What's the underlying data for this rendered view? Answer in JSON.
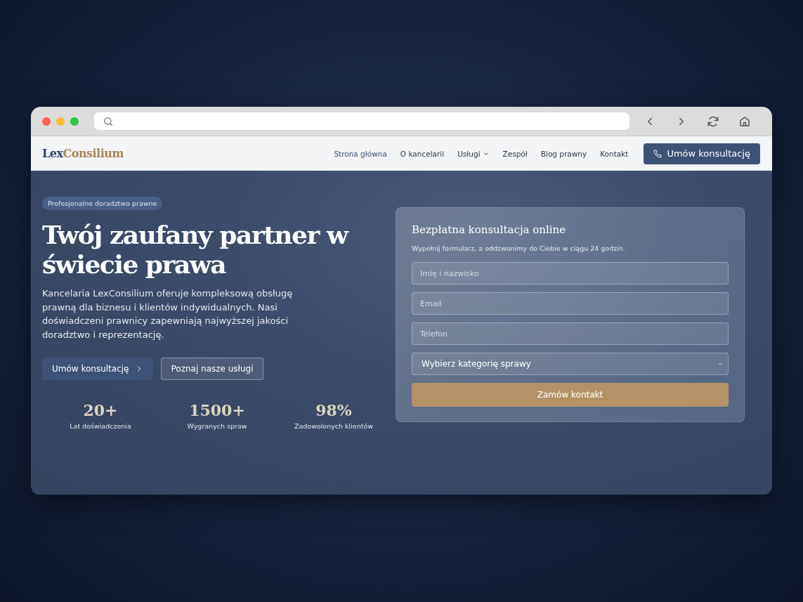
{
  "header": {
    "logo": {
      "first": "Lex",
      "second": "Consilium"
    },
    "nav": [
      {
        "label": "Strona główna",
        "selected": true,
        "kind": "link"
      },
      {
        "label": "O kancelarii",
        "selected": false,
        "kind": "link"
      },
      {
        "label": "Usługi",
        "selected": false,
        "kind": "dropdown"
      },
      {
        "label": "Zespół",
        "selected": false,
        "kind": "link"
      },
      {
        "label": "Blog prawny",
        "selected": false,
        "kind": "link"
      },
      {
        "label": "Kontakt",
        "selected": false,
        "kind": "link"
      }
    ],
    "cta": "Umów konsultację"
  },
  "hero": {
    "badge": "Profesjonalne doradztwo prawne",
    "title": "Twój zaufany partner w świecie prawa",
    "description": "Kancelaria LexConsilium oferuje kompleksową obsługę prawną dla biznesu i klientów indywidualnych. Nasi doświadczeni prawnicy zapewniają najwyższej jakości doradztwo i reprezentację.",
    "buttons": [
      {
        "label": "Umów konsultację",
        "kind": "primary"
      },
      {
        "label": "Poznaj nasze usługi",
        "kind": "secondary"
      }
    ],
    "stats": [
      {
        "value": "20+",
        "label": "Lat doświadczenia"
      },
      {
        "value": "1500+",
        "label": "Wygranych spraw"
      },
      {
        "value": "98%",
        "label": "Zadowolonych klientów"
      }
    ]
  },
  "form": {
    "title": "Bezpłatna konsultacja online",
    "subtitle": "Wypełnij formularz, a oddzwonimy do Ciebie w ciągu 24 godzin.",
    "fields": [
      {
        "kind": "text",
        "placeholder": "Imię i nazwisko"
      },
      {
        "kind": "text",
        "placeholder": "Email"
      },
      {
        "kind": "text",
        "placeholder": "Telefon"
      },
      {
        "kind": "select",
        "value": "Wybierz kategorię sprawy"
      }
    ],
    "submit": "Zamów kontakt"
  }
}
